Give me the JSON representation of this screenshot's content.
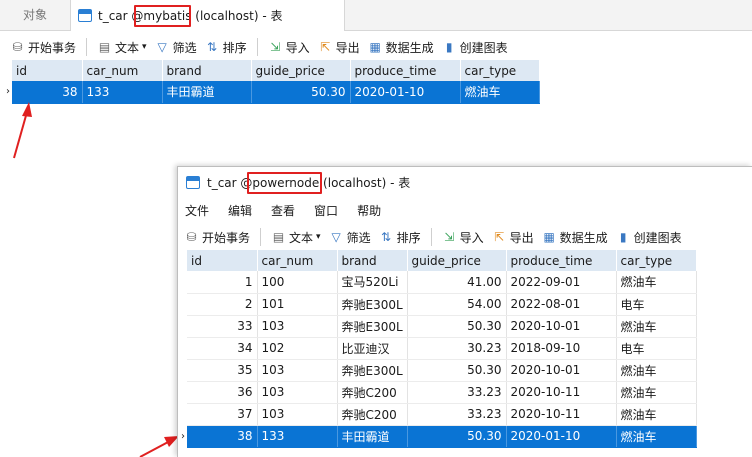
{
  "top_window": {
    "tab_objects": "对象",
    "tab_title_prefix": "t_car @",
    "tab_db": "mybatis",
    "tab_title_suffix": " (localhost) - 表",
    "toolbar": {
      "begin_transaction": "开始事务",
      "text": "文本",
      "filter": "筛选",
      "sort": "排序",
      "import": "导入",
      "export": "导出",
      "data_generation": "数据生成",
      "create_chart": "创建图表"
    },
    "columns": [
      "id",
      "car_num",
      "brand",
      "guide_price",
      "produce_time",
      "car_type"
    ],
    "rows": [
      {
        "id": "38",
        "car_num": "133",
        "brand": "丰田霸道",
        "guide_price": "50.30",
        "produce_time": "2020-01-10",
        "car_type": "燃油车"
      }
    ]
  },
  "bottom_window": {
    "title_prefix": "t_car @",
    "title_db": "powernode",
    "title_suffix": " (localhost) - 表",
    "menu": [
      "文件",
      "编辑",
      "查看",
      "窗口",
      "帮助"
    ],
    "toolbar": {
      "begin_transaction": "开始事务",
      "text": "文本",
      "filter": "筛选",
      "sort": "排序",
      "import": "导入",
      "export": "导出",
      "data_generation": "数据生成",
      "create_chart": "创建图表"
    },
    "columns": [
      "id",
      "car_num",
      "brand",
      "guide_price",
      "produce_time",
      "car_type"
    ],
    "rows": [
      {
        "id": "1",
        "car_num": "100",
        "brand": "宝马520Li",
        "guide_price": "41.00",
        "produce_time": "2022-09-01",
        "car_type": "燃油车"
      },
      {
        "id": "2",
        "car_num": "101",
        "brand": "奔驰E300L",
        "guide_price": "54.00",
        "produce_time": "2022-08-01",
        "car_type": "电车"
      },
      {
        "id": "33",
        "car_num": "103",
        "brand": "奔驰E300L",
        "guide_price": "50.30",
        "produce_time": "2020-10-01",
        "car_type": "燃油车"
      },
      {
        "id": "34",
        "car_num": "102",
        "brand": "比亚迪汉",
        "guide_price": "30.23",
        "produce_time": "2018-09-10",
        "car_type": "电车"
      },
      {
        "id": "35",
        "car_num": "103",
        "brand": "奔驰E300L",
        "guide_price": "50.30",
        "produce_time": "2020-10-01",
        "car_type": "燃油车"
      },
      {
        "id": "36",
        "car_num": "103",
        "brand": "奔驰C200",
        "guide_price": "33.23",
        "produce_time": "2020-10-11",
        "car_type": "燃油车"
      },
      {
        "id": "37",
        "car_num": "103",
        "brand": "奔驰C200",
        "guide_price": "33.23",
        "produce_time": "2020-10-11",
        "car_type": "燃油车"
      },
      {
        "id": "38",
        "car_num": "133",
        "brand": "丰田霸道",
        "guide_price": "50.30",
        "produce_time": "2020-01-10",
        "car_type": "燃油车"
      }
    ]
  },
  "colors": {
    "selection": "#0a74d4",
    "header_bg": "#dde8f3",
    "highlight_box": "#e02020",
    "annotation_arrow": "#e02020"
  }
}
